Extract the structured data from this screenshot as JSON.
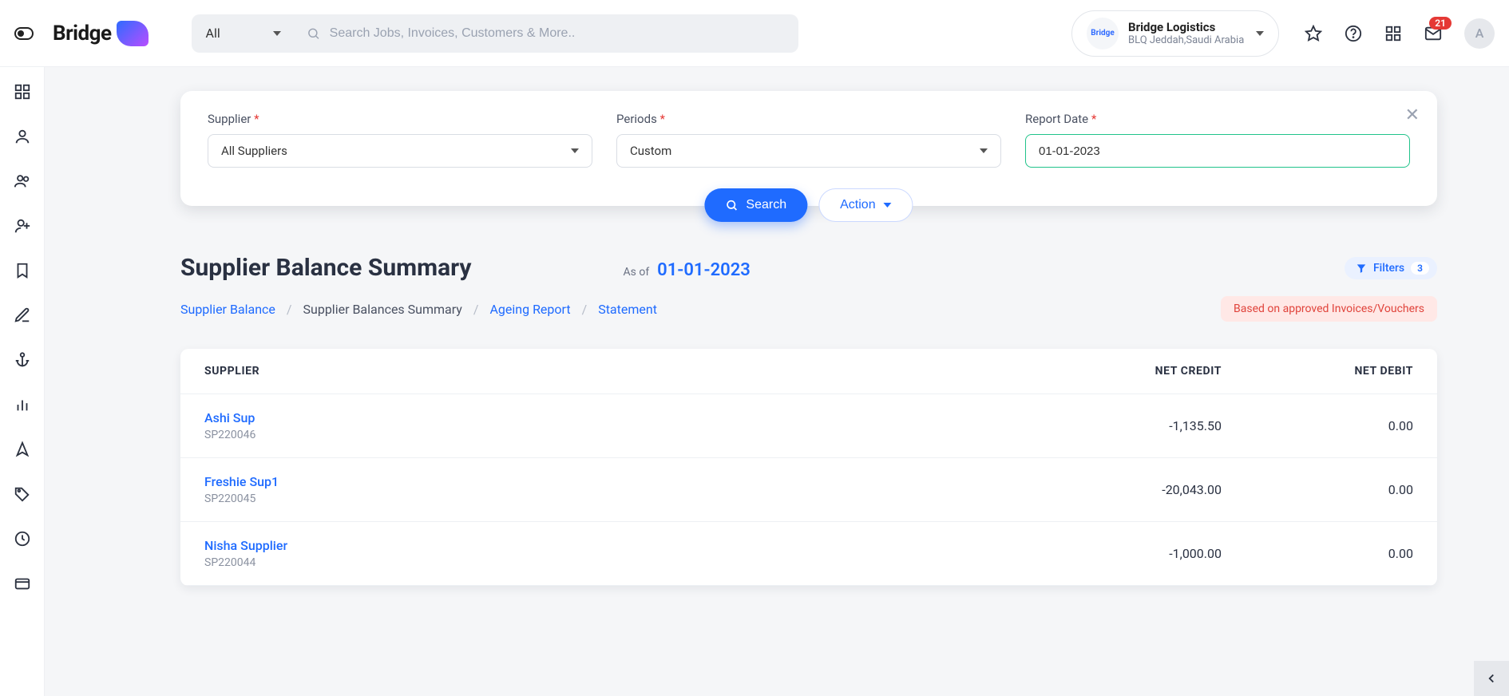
{
  "header": {
    "logo_text": "Bridge",
    "search_category": "All",
    "search_placeholder": "Search Jobs, Invoices, Customers & More..",
    "org_name": "Bridge Logistics",
    "org_location": "BLQ Jeddah,Saudi Arabia",
    "notification_count": "21",
    "avatar_initial": "A"
  },
  "filters": {
    "supplier_label": "Supplier",
    "supplier_value": "All Suppliers",
    "periods_label": "Periods",
    "periods_value": "Custom",
    "report_date_label": "Report Date",
    "report_date_value": "01-01-2023",
    "search_btn": "Search",
    "action_btn": "Action"
  },
  "page": {
    "title": "Supplier Balance Summary",
    "asof_label": "As of",
    "asof_date": "01-01-2023",
    "filters_label": "Filters",
    "filters_count": "3",
    "note": "Based on approved Invoices/Vouchers"
  },
  "crumbs": {
    "c1": "Supplier Balance",
    "c2": "Supplier Balances Summary",
    "c3": "Ageing Report",
    "c4": "Statement"
  },
  "table": {
    "h1": "SUPPLIER",
    "h2": "NET CREDIT",
    "h3": "NET DEBIT",
    "rows": [
      {
        "name": "Ashi Sup",
        "id": "SP220046",
        "credit": "-1,135.50",
        "debit": "0.00"
      },
      {
        "name": "Freshie Sup1",
        "id": "SP220045",
        "credit": "-20,043.00",
        "debit": "0.00"
      },
      {
        "name": "Nisha Supplier",
        "id": "SP220044",
        "credit": "-1,000.00",
        "debit": "0.00"
      }
    ]
  },
  "colors": {
    "primary": "#1f6bff",
    "danger": "#e53935",
    "accent": "#21c38a"
  }
}
